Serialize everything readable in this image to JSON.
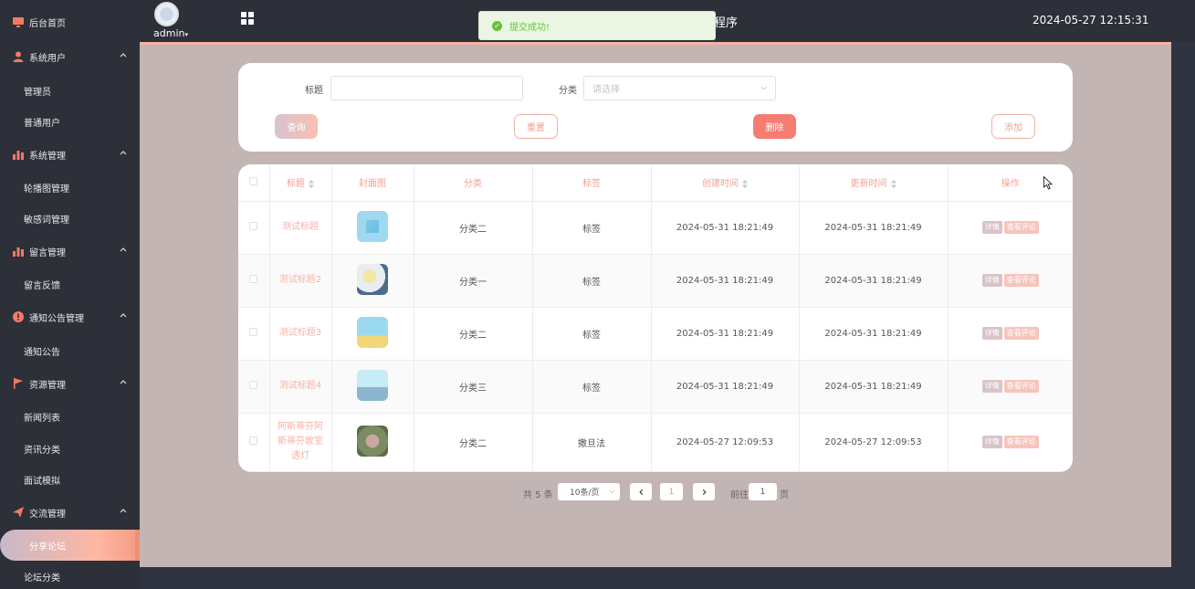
{
  "header": {
    "user_label": "admin",
    "title_partial": "程序",
    "datetime": "2024-05-27 12:15:31",
    "toast_text": "提交成功!"
  },
  "sidebar": {
    "items": [
      {
        "label": "后台首页",
        "kind": "group",
        "icon": "monitor-icon"
      },
      {
        "label": "系统用户",
        "kind": "group",
        "icon": "user-icon"
      },
      {
        "label": "管理员",
        "kind": "sub"
      },
      {
        "label": "普通用户",
        "kind": "sub"
      },
      {
        "label": "系统管理",
        "kind": "group",
        "icon": "bar-chart-icon"
      },
      {
        "label": "轮播图管理",
        "kind": "sub"
      },
      {
        "label": "敏感词管理",
        "kind": "sub"
      },
      {
        "label": "留言管理",
        "kind": "group",
        "icon": "bar-chart-icon"
      },
      {
        "label": "留言反馈",
        "kind": "sub"
      },
      {
        "label": "通知公告管理",
        "kind": "group",
        "icon": "info-circle-icon"
      },
      {
        "label": "通知公告",
        "kind": "sub"
      },
      {
        "label": "资源管理",
        "kind": "group",
        "icon": "flag-icon"
      },
      {
        "label": "新闻列表",
        "kind": "sub"
      },
      {
        "label": "资讯分类",
        "kind": "sub"
      },
      {
        "label": "面试模拟",
        "kind": "sub"
      },
      {
        "label": "交流管理",
        "kind": "group",
        "icon": "paper-plane-icon"
      },
      {
        "label": "分享论坛",
        "kind": "active"
      },
      {
        "label": "论坛分类",
        "kind": "sub"
      }
    ]
  },
  "search": {
    "title_label": "标题",
    "title_value": "",
    "category_label": "分类",
    "category_placeholder": "请选择",
    "query_button": "查询",
    "reset_button": "重置",
    "delete_button": "删除",
    "add_button": "添加"
  },
  "table": {
    "headers": [
      "标题",
      "封面图",
      "分类",
      "标签",
      "创建时间",
      "更新时间",
      "操作"
    ],
    "rows": [
      {
        "title": "测试标题",
        "category": "分类二",
        "tag": "标签",
        "created": "2024-05-31 18:21:49",
        "updated": "2024-05-31 18:21:49"
      },
      {
        "title": "测试标题2",
        "category": "分类一",
        "tag": "标签",
        "created": "2024-05-31 18:21:49",
        "updated": "2024-05-31 18:21:49"
      },
      {
        "title": "测试标题3",
        "category": "分类二",
        "tag": "标签",
        "created": "2024-05-31 18:21:49",
        "updated": "2024-05-31 18:21:49"
      },
      {
        "title": "测试标题4",
        "category": "分类三",
        "tag": "标签",
        "created": "2024-05-31 18:21:49",
        "updated": "2024-05-31 18:21:49"
      },
      {
        "title": "阿斯蒂芬阿斯蒂芬敢室透灯",
        "category": "分类二",
        "tag": "撒旦法",
        "created": "2024-05-27 12:09:53",
        "updated": "2024-05-27 12:09:53"
      }
    ],
    "action_detail": "详情",
    "action_comments": "查看评论"
  },
  "pagination": {
    "total": "共 5 条",
    "page_size": "10条/页",
    "current_page": "1",
    "goto_label": "前往",
    "goto_value": "1",
    "page_suffix": "页"
  },
  "colors": {
    "accent": "#f08f74",
    "sidebar_bg": "#2d3039",
    "main_bg": "#c3b5b4",
    "success": "#67c23a"
  }
}
